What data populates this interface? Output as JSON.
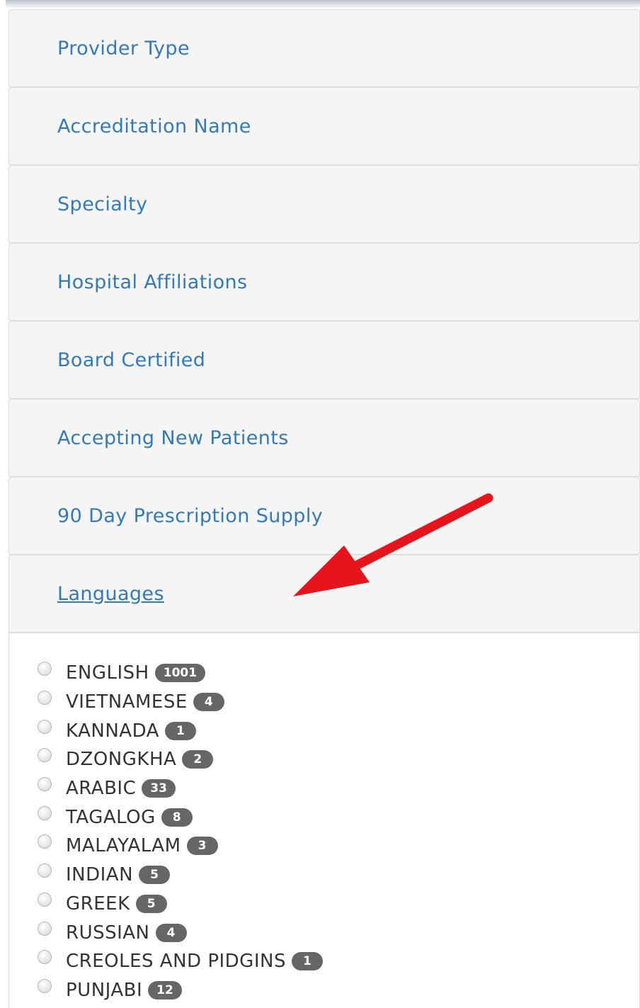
{
  "filters": [
    {
      "label": "Provider Type"
    },
    {
      "label": "Accreditation Name"
    },
    {
      "label": "Specialty"
    },
    {
      "label": "Hospital Affiliations"
    },
    {
      "label": "Board Certified"
    },
    {
      "label": "Accepting New Patients"
    },
    {
      "label": "90 Day Prescription Supply"
    },
    {
      "label": "Languages"
    }
  ],
  "languages": [
    {
      "label": "ENGLISH",
      "count": "1001"
    },
    {
      "label": "VIETNAMESE",
      "count": "4"
    },
    {
      "label": "KANNADA",
      "count": "1"
    },
    {
      "label": "DZONGKHA",
      "count": "2"
    },
    {
      "label": "ARABIC",
      "count": "33"
    },
    {
      "label": "TAGALOG",
      "count": "8"
    },
    {
      "label": "MALAYALAM",
      "count": "3"
    },
    {
      "label": "INDIAN",
      "count": "5"
    },
    {
      "label": "GREEK",
      "count": "5"
    },
    {
      "label": "RUSSIAN",
      "count": "4"
    },
    {
      "label": "CREOLES AND PIDGINS",
      "count": "1"
    },
    {
      "label": "PUNJABI",
      "count": "12"
    }
  ],
  "colors": {
    "link": "#337ab7",
    "panel_bg": "#f5f5f5",
    "badge_bg": "#666666",
    "annotation_arrow": "#e8141b"
  },
  "annotation": {
    "icon": "red-arrow-icon"
  }
}
